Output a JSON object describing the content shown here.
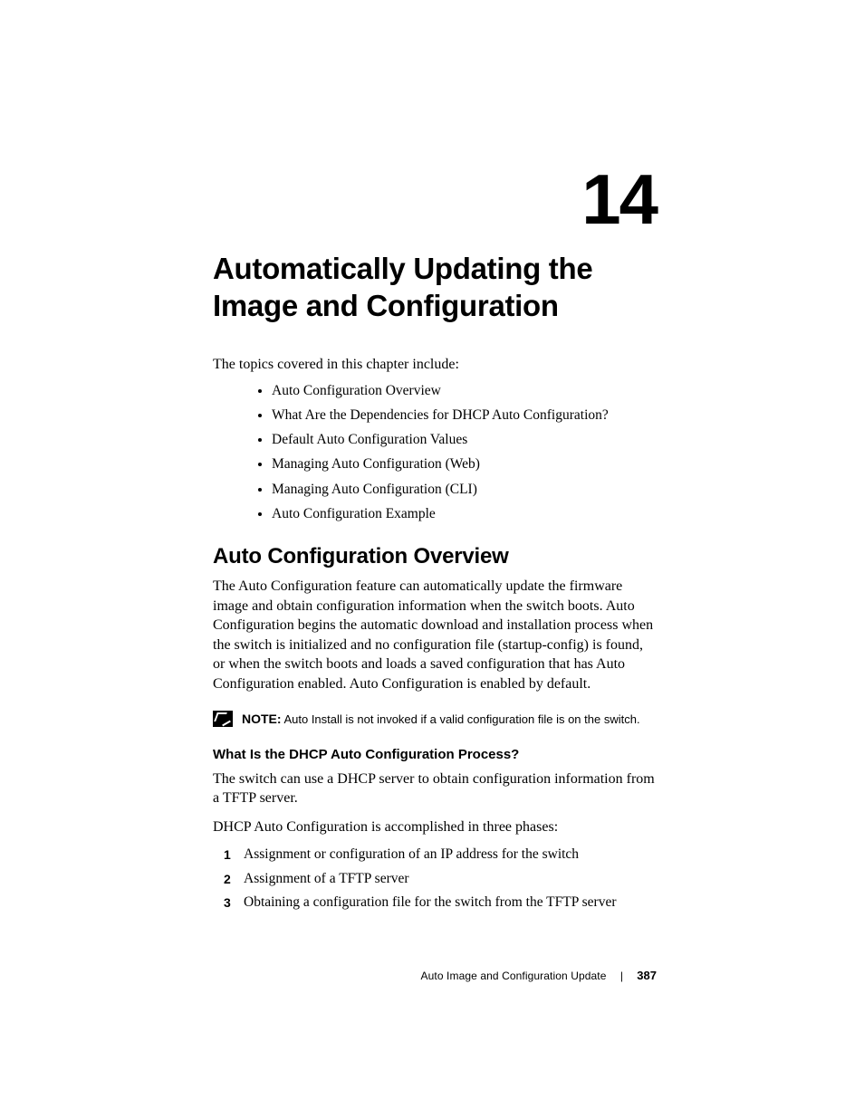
{
  "chapter": {
    "number": "14",
    "title": "Automatically Updating the Image and Configuration"
  },
  "intro": "The topics covered in this chapter include:",
  "topics": [
    "Auto Configuration Overview",
    "What Are the Dependencies for DHCP Auto Configuration?",
    "Default Auto Configuration Values",
    "Managing Auto Configuration (Web)",
    "Managing Auto Configuration (CLI)",
    "Auto Configuration Example"
  ],
  "section": {
    "heading": "Auto Configuration Overview",
    "body": "The Auto Configuration feature can automatically update the firmware image and obtain configuration information when the switch boots. Auto Configuration begins the automatic download and installation process when the switch is initialized and no configuration file (startup-config) is found, or when the switch boots and loads a saved configuration that has Auto Configuration enabled. Auto Configuration is enabled by default."
  },
  "note": {
    "label": "NOTE:",
    "text": "Auto Install is not invoked if a valid configuration file is on the switch."
  },
  "subsection": {
    "heading": "What Is the DHCP Auto Configuration Process?",
    "p1": "The switch can use a DHCP server to obtain configuration information from a TFTP server.",
    "p2": "DHCP Auto Configuration is accomplished in three phases:",
    "phases": [
      "Assignment or configuration of an IP address for the switch",
      "Assignment of a TFTP server",
      "Obtaining a configuration file for the switch from the TFTP server"
    ]
  },
  "footer": {
    "section_title": "Auto Image and Configuration Update",
    "separator": "|",
    "page": "387"
  }
}
